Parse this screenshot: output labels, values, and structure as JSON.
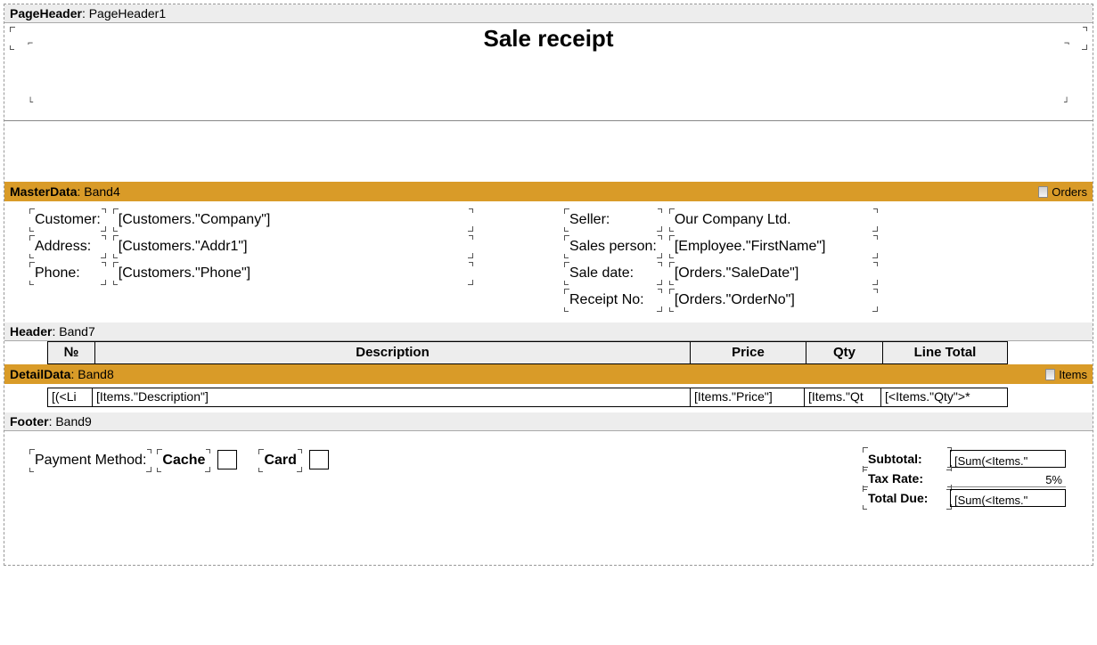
{
  "pageHeader": {
    "band_type": "PageHeader",
    "band_name": "PageHeader1",
    "title": "Sale receipt"
  },
  "masterData": {
    "band_type": "MasterData",
    "band_name": "Band4",
    "dataset": "Orders",
    "left": {
      "labels": [
        "Customer:",
        "Address:",
        "Phone:"
      ],
      "values": [
        "[Customers.\"Company\"]",
        "[Customers.\"Addr1\"]",
        "[Customers.\"Phone\"]"
      ]
    },
    "right": {
      "labels": [
        "Seller:",
        "Sales person:",
        "Sale date:",
        "Receipt No:"
      ],
      "values": [
        "Our Company Ltd.",
        "[Employee.\"FirstName\"]",
        "[Orders.\"SaleDate\"]",
        "[Orders.\"OrderNo\"]"
      ]
    }
  },
  "header": {
    "band_type": "Header",
    "band_name": "Band7",
    "columns": [
      "№",
      "Description",
      "Price",
      "Qty",
      "Line Total"
    ]
  },
  "detail": {
    "band_type": "DetailData",
    "band_name": "Band8",
    "dataset": "Items",
    "row": [
      "[(<Li",
      "[Items.\"Description\"]",
      "[Items.\"Price\"]",
      "[Items.\"Qt",
      "[<Items.\"Qty\">*"
    ]
  },
  "footer": {
    "band_type": "Footer",
    "band_name": "Band9",
    "payment_label": "Payment Method:",
    "cache_label": "Cache",
    "card_label": "Card",
    "totals": {
      "subtotal_label": "Subtotal:",
      "subtotal_value": "[Sum(<Items.\"",
      "taxrate_label": "Tax Rate:",
      "taxrate_value": "5%",
      "totaldue_label": "Total Due:",
      "totaldue_value": "[Sum(<Items.\""
    }
  }
}
